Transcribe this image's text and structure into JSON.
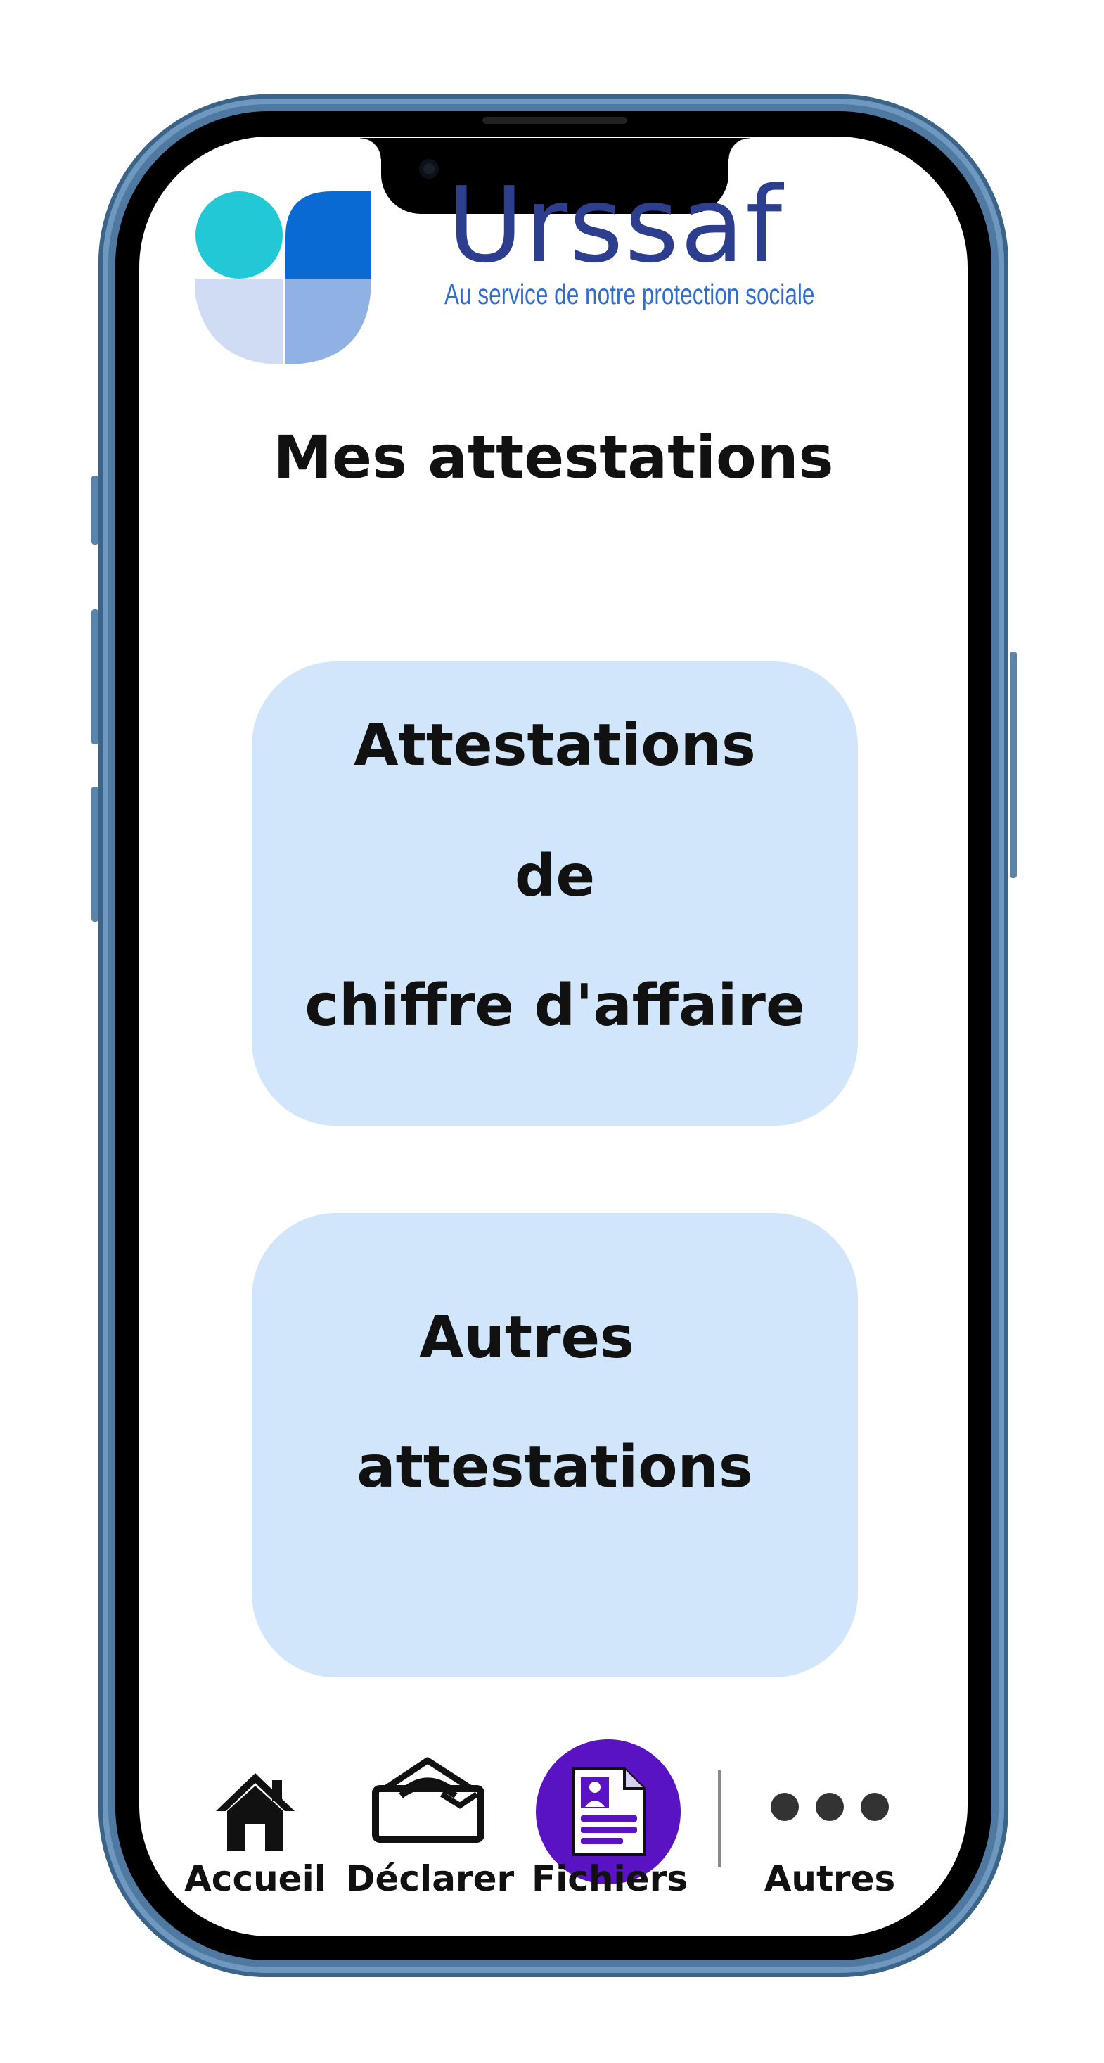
{
  "app": {
    "logo_name": "Urssaf",
    "tagline": "Au service de notre protection sociale"
  },
  "page": {
    "title": "Mes attestations"
  },
  "cards": [
    {
      "lines": [
        "Attestations",
        "de",
        "chiffre d'affaire"
      ]
    },
    {
      "lines": [
        "Autres",
        "attestations"
      ]
    }
  ],
  "bottom_nav": {
    "items": [
      {
        "label": "Accueil",
        "icon": "home-icon",
        "active": false
      },
      {
        "label": "Déclarer",
        "icon": "declare-envelope-icon",
        "active": false
      },
      {
        "label": "Fichiers",
        "icon": "document-icon",
        "active": true
      },
      {
        "label": "Autres",
        "icon": "more-dots-icon",
        "active": false
      }
    ]
  },
  "colors": {
    "brand_navy": "#2d3e8f",
    "brand_blue": "#0a6ad4",
    "brand_cyan": "#22c8d6",
    "card_background": "#d1e6fb",
    "active_nav": "#5a13c2",
    "phone_frame": "#4f79a0"
  }
}
